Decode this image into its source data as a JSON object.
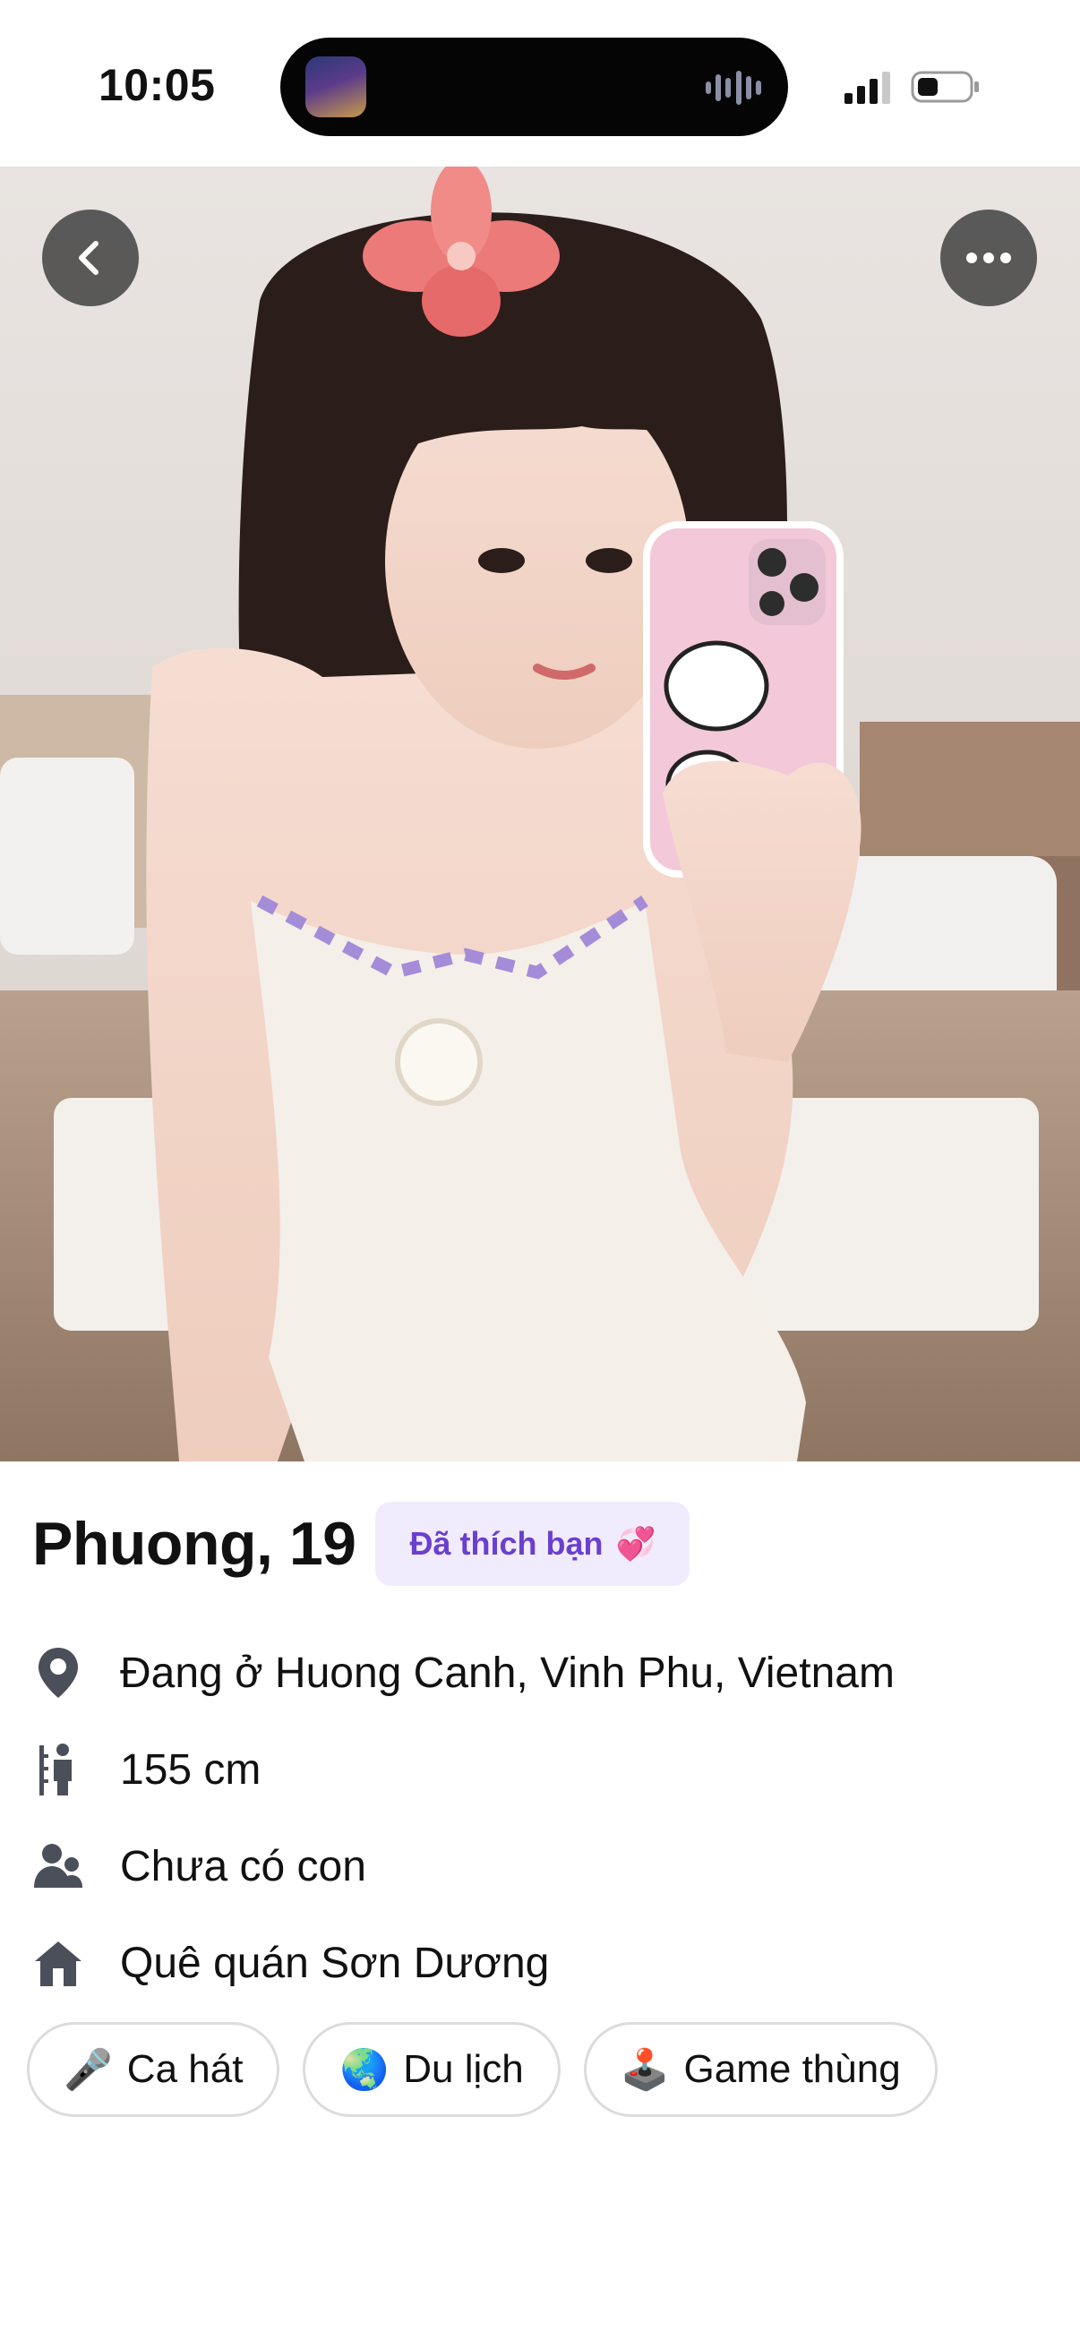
{
  "status_bar": {
    "time": "10:05",
    "signal_icon": "cellular-signal-icon",
    "battery_icon": "battery-icon"
  },
  "header": {
    "back_icon": "chevron-left-icon",
    "more_icon": "more-horizontal-icon"
  },
  "profile": {
    "name_age": "Phuong, 19",
    "liked_badge": {
      "text": "Đã thích bạn",
      "emoji": "💞"
    },
    "details": [
      {
        "icon": "location-pin-icon",
        "text": "Đang ở Huong Canh, Vinh Phu, Vietnam"
      },
      {
        "icon": "height-icon",
        "text": "155 cm"
      },
      {
        "icon": "children-icon",
        "text": "Chưa có con"
      },
      {
        "icon": "home-icon",
        "text": "Quê quán Sơn Dương"
      }
    ],
    "interests": [
      {
        "emoji": "🎤",
        "label": "Ca hát"
      },
      {
        "emoji": "🌏",
        "label": "Du lịch"
      },
      {
        "emoji": "🕹️",
        "label": "Game thùng"
      }
    ]
  },
  "colors": {
    "badge_bg": "#f1ecfd",
    "badge_text": "#6a3fd0",
    "icon_gray": "#4a4f5a"
  }
}
